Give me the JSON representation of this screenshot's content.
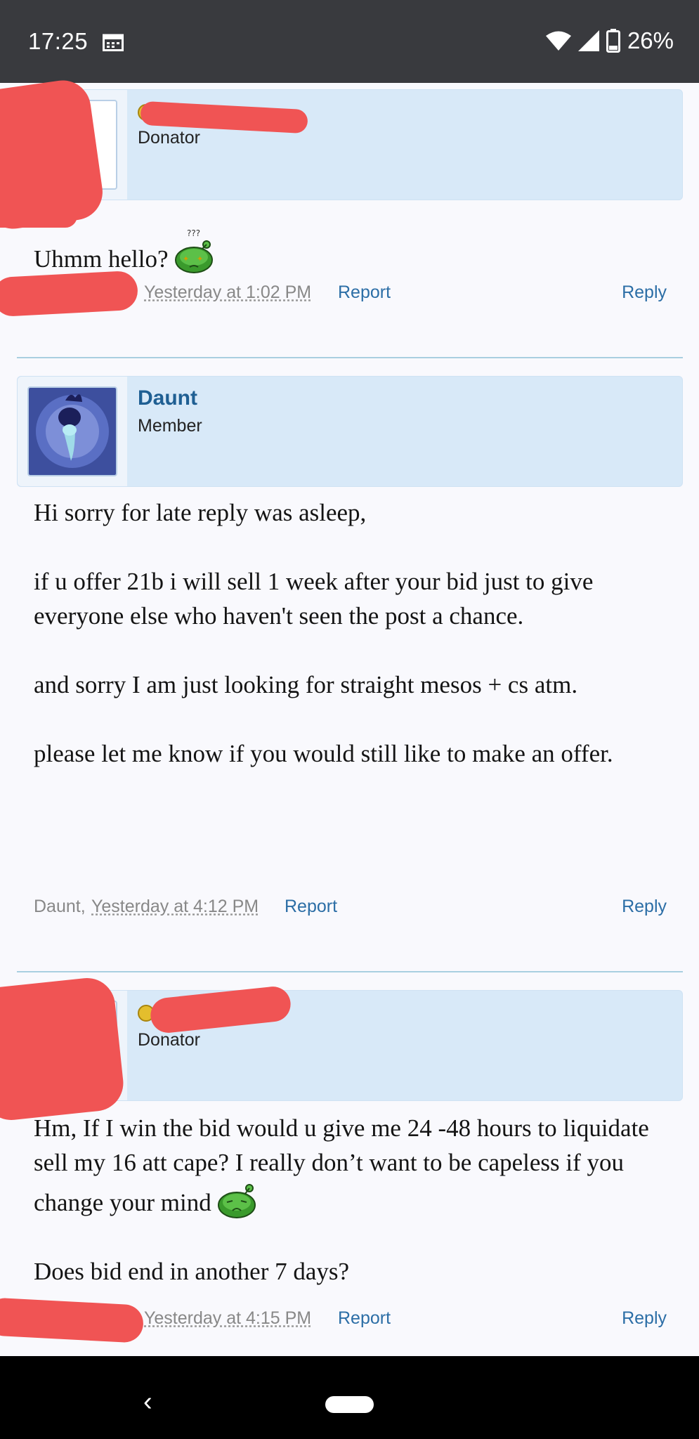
{
  "status_bar": {
    "time": "17:25",
    "battery": "26%",
    "icons": [
      "calendar-icon",
      "wifi-icon",
      "signal-icon",
      "battery-icon"
    ]
  },
  "posts": [
    {
      "user_title": "Donator",
      "message": [
        "Uhmm hello?"
      ],
      "emoticon": "confused-slime-emoticon",
      "date": "Yesterday at 1:02 PM",
      "report": "Report",
      "reply": "Reply"
    },
    {
      "username": "Daunt",
      "user_title": "Member",
      "message": [
        "Hi sorry for late reply was asleep,",
        "if u offer 21b i will sell 1 week after your bid just to give everyone else who haven't seen the post a chance.",
        "and sorry I am just looking for straight mesos + cs atm.",
        "please let me know if you would still like to make an offer."
      ],
      "author": "Daunt,",
      "date": "Yesterday at 4:12 PM",
      "report": "Report",
      "reply": "Reply"
    },
    {
      "user_title": "Donator",
      "message": [
        "Hm, If I win the bid would u give me 24 -48 hours to liquidate sell my 16 att cape? I really don’t want to be capeless if you change your mind",
        "Does bid end in another 7 days?"
      ],
      "emoticon": "sad-slime-emoticon",
      "date": "Yesterday at 4:15 PM",
      "report": "Report",
      "reply": "Reply"
    }
  ],
  "colors": {
    "header_bg": "#d8e9f8",
    "link": "#2c6ea6",
    "username": "#1f5f93",
    "redaction": "#f05454"
  }
}
